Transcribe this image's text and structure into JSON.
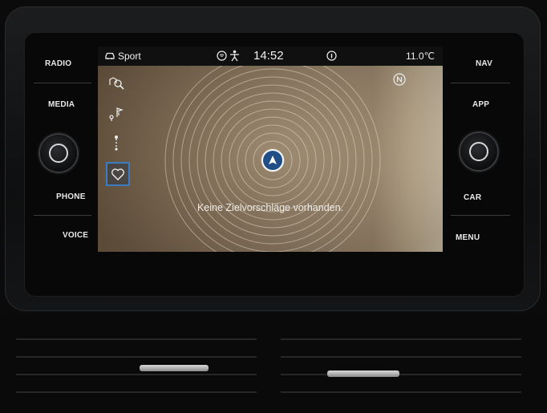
{
  "hardware_buttons": {
    "left": [
      "RADIO",
      "MEDIA",
      "PHONE",
      "VOICE"
    ],
    "right": [
      "NAV",
      "APP",
      "CAR",
      "MENU"
    ]
  },
  "status_bar": {
    "drive_mode": "Sport",
    "time": "14:52",
    "temperature": "11.0℃",
    "icons": [
      "car-icon",
      "wireless-icon",
      "person-icon",
      "info-circle-icon"
    ]
  },
  "navigation": {
    "empty_message": "Keine Zielvorschläge vorhanden.",
    "side_menu": [
      {
        "icon": "destination-search-icon",
        "active": false
      },
      {
        "icon": "route-flags-icon",
        "active": false
      },
      {
        "icon": "poi-pin-icon",
        "active": false
      },
      {
        "icon": "favorites-heart-icon",
        "active": true
      }
    ],
    "compass": "N"
  },
  "colors": {
    "accent": "#3d7cc0",
    "position_marker": "#1f4f86"
  }
}
